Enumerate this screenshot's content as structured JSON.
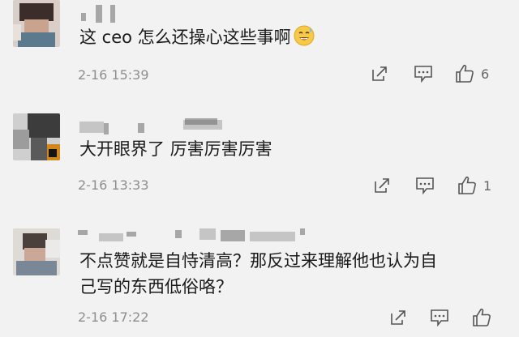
{
  "comments": [
    {
      "text": "这 ceo 怎么还操心这些事啊",
      "emoji": "sweat-smile-emoji",
      "time": "2-16 15:39",
      "likes": "6"
    },
    {
      "text": "大开眼界了 厉害厉害厉害",
      "time": "2-16 13:33",
      "likes": "1"
    },
    {
      "text_line1": "不点赞就是自恃清高？那反过来理解他也认为自",
      "text_line2": "己写的东西低俗咯？",
      "time": "2-16 17:22",
      "likes": ""
    }
  ],
  "icons": {
    "share": "share-icon",
    "reply": "comment-reply-icon",
    "like": "thumbs-up-icon"
  },
  "colors": {
    "background": "#f2f2f2",
    "text": "#1a1a1a",
    "meta": "#8e8e8e",
    "icon": "#555555"
  }
}
